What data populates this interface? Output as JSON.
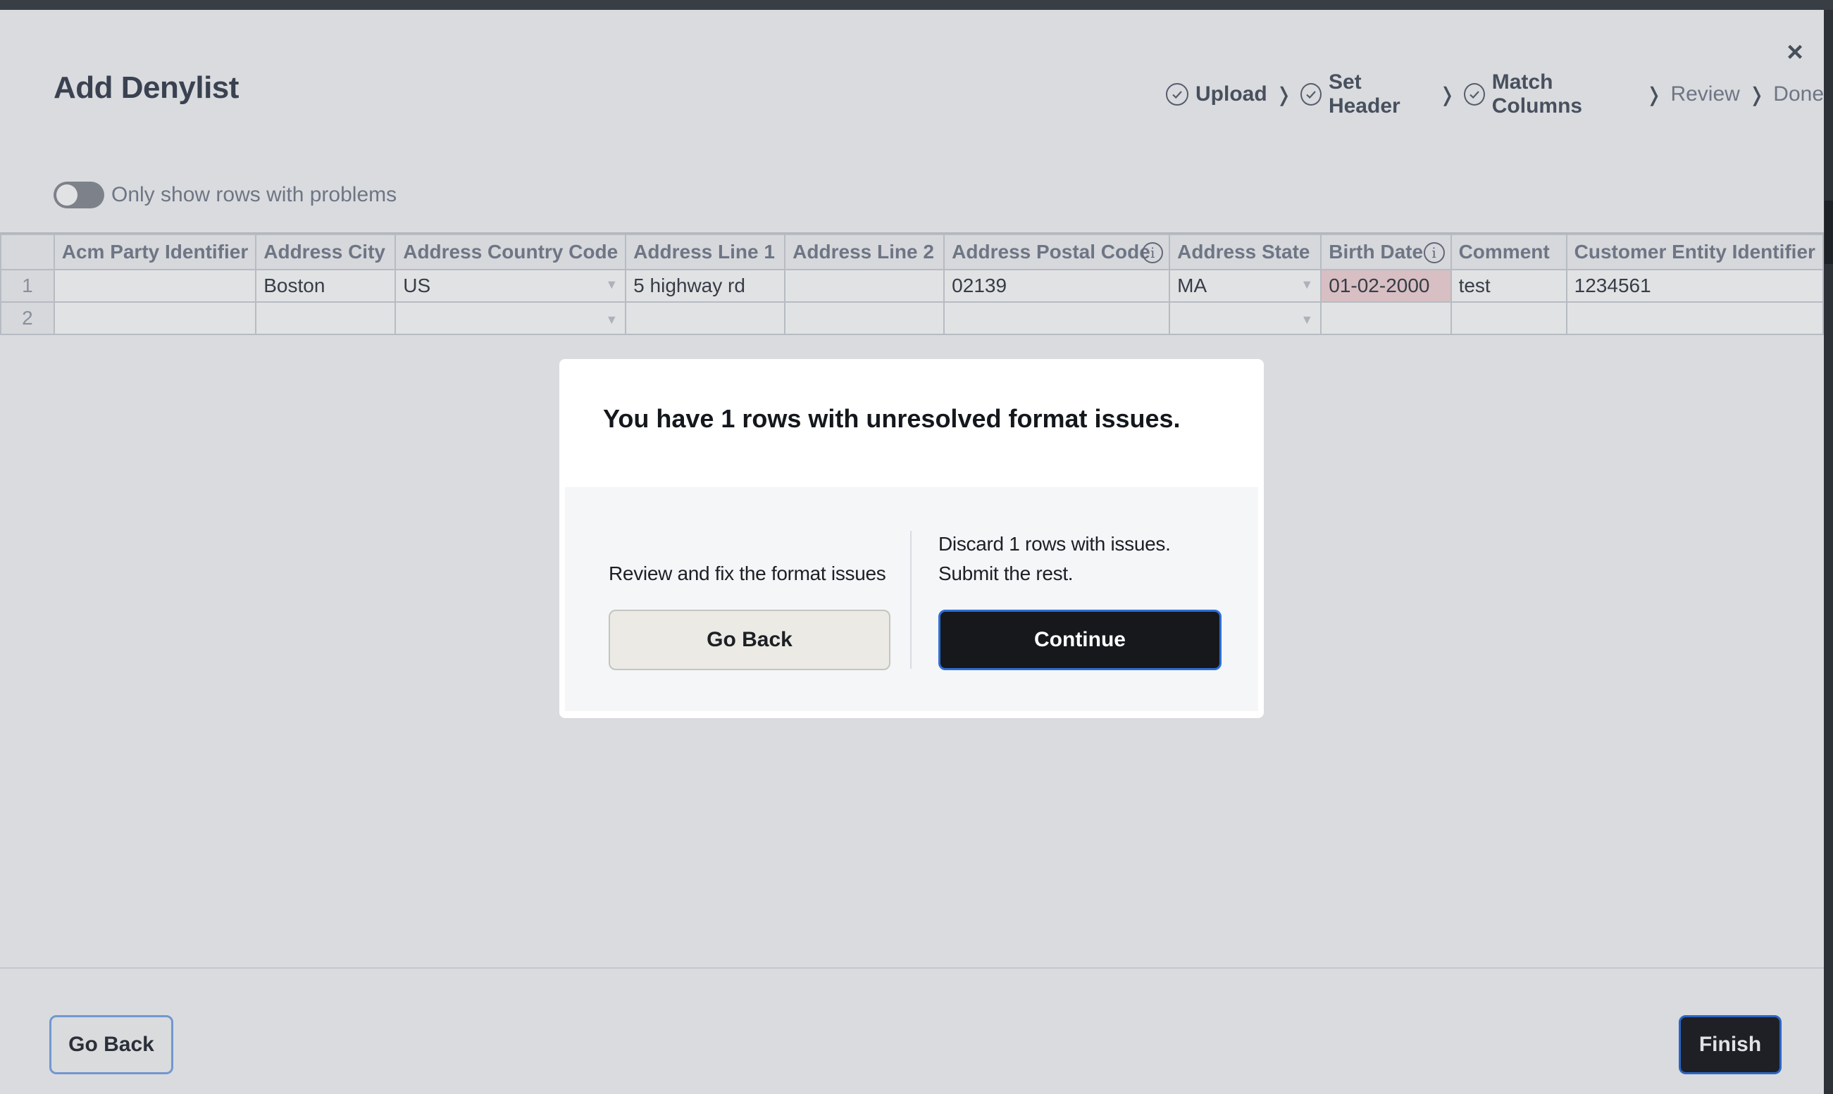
{
  "header": {
    "title": "Add Denylist",
    "close_symbol": "×"
  },
  "steps": [
    {
      "label": "Upload",
      "done": true
    },
    {
      "label": "Set Header",
      "done": true
    },
    {
      "label": "Match Columns",
      "done": true
    },
    {
      "label": "Review",
      "done": false
    },
    {
      "label": "Done",
      "done": false
    }
  ],
  "step_separator": "❭",
  "filter": {
    "toggle_label": "Only show rows with problems",
    "toggle_on": false
  },
  "table": {
    "columns": [
      "Acm Party Identifier",
      "Address City",
      "Address Country Code",
      "Address Line 1",
      "Address Line 2",
      "Address Postal Code",
      "Address State",
      "Birth Date",
      "Comment",
      "Customer Entity Identifier"
    ],
    "info_icon_columns": [
      "Address Postal Code",
      "Birth Date"
    ],
    "dropdown_columns": [
      "Address Country Code",
      "Address State"
    ],
    "rows": [
      {
        "num": "1",
        "cells": [
          "",
          "Boston",
          "US",
          "5 highway rd",
          "",
          "02139",
          "MA",
          "01-02-2000",
          "test",
          "1234561"
        ]
      },
      {
        "num": "2",
        "cells": [
          "",
          "",
          "",
          "",
          "",
          "",
          "",
          "",
          "",
          ""
        ]
      }
    ],
    "error_cell": {
      "row": 0,
      "column": "Birth Date"
    },
    "error_color": "#f4d7d9"
  },
  "dialog": {
    "title": "You have 1 rows with unresolved format issues.",
    "left_text": "Review and fix the format issues",
    "left_button": "Go Back",
    "right_text": "Discard 1 rows with issues. Submit the rest.",
    "right_button": "Continue"
  },
  "footer": {
    "back_label": "Go Back",
    "finish_label": "Finish"
  },
  "colors": {
    "primary_dark": "#1c1e22",
    "focus_blue": "#2d6ed8",
    "text_muted": "#7a8190"
  }
}
